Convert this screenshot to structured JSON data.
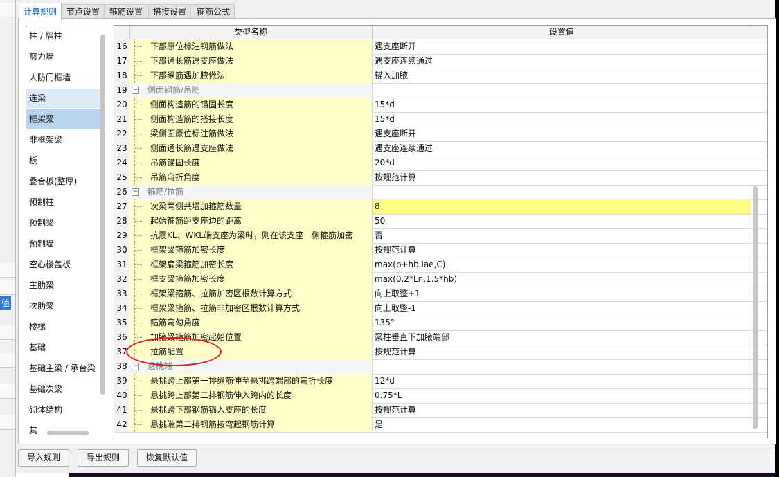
{
  "background_edge": {
    "left_label": "值"
  },
  "tabs": [
    {
      "label": "计算规则",
      "active": true
    },
    {
      "label": "节点设置",
      "active": false
    },
    {
      "label": "箍筋设置",
      "active": false
    },
    {
      "label": "搭接设置",
      "active": false
    },
    {
      "label": "箍筋公式",
      "active": false
    }
  ],
  "categories": [
    {
      "label": "柱 / 墙柱",
      "state": ""
    },
    {
      "label": "剪力墙",
      "state": ""
    },
    {
      "label": "人防门框墙",
      "state": ""
    },
    {
      "label": "连梁",
      "state": "hover"
    },
    {
      "label": "框架梁",
      "state": "selected"
    },
    {
      "label": "非框架梁",
      "state": ""
    },
    {
      "label": "板",
      "state": ""
    },
    {
      "label": "叠合板(整厚)",
      "state": ""
    },
    {
      "label": "预制柱",
      "state": ""
    },
    {
      "label": "预制梁",
      "state": ""
    },
    {
      "label": "预制墙",
      "state": ""
    },
    {
      "label": "空心楼盖板",
      "state": ""
    },
    {
      "label": "主肋梁",
      "state": ""
    },
    {
      "label": "次肋梁",
      "state": ""
    },
    {
      "label": "楼梯",
      "state": ""
    },
    {
      "label": "基础",
      "state": ""
    },
    {
      "label": "基础主梁 / 承台梁",
      "state": ""
    },
    {
      "label": "基础次梁",
      "state": ""
    },
    {
      "label": "砌体结构",
      "state": ""
    },
    {
      "label": "其",
      "state": ""
    }
  ],
  "grid": {
    "columns": [
      "类型名称",
      "设置值"
    ],
    "rows": [
      {
        "num": "16",
        "name": "下部原位标注钢筋做法",
        "value": "遇支座断开"
      },
      {
        "num": "17",
        "name": "下部通长筋遇支座做法",
        "value": "遇支座连续通过"
      },
      {
        "num": "18",
        "name": "下部纵筋遇加腋做法",
        "value": "锚入加腋"
      },
      {
        "num": "19",
        "name": "侧面钢筋/吊筋",
        "value": "",
        "group": true
      },
      {
        "num": "20",
        "name": "侧面构造筋的锚固长度",
        "value": "15*d"
      },
      {
        "num": "21",
        "name": "侧面构造筋的搭接长度",
        "value": "15*d"
      },
      {
        "num": "22",
        "name": "梁侧面原位标注筋做法",
        "value": "遇支座断开"
      },
      {
        "num": "23",
        "name": "侧面通长筋遇支座做法",
        "value": "遇支座连续通过"
      },
      {
        "num": "24",
        "name": "吊筋锚固长度",
        "value": "20*d"
      },
      {
        "num": "25",
        "name": "吊筋弯折角度",
        "value": "按规范计算"
      },
      {
        "num": "26",
        "name": "箍筋/拉筋",
        "value": "",
        "group": true
      },
      {
        "num": "27",
        "name": "次梁两侧共增加箍筋数量",
        "value": "8",
        "highlight": true
      },
      {
        "num": "28",
        "name": "起始箍筋距支座边的距离",
        "value": "50"
      },
      {
        "num": "29",
        "name": "抗震KL、WKL端支座为梁时，则在该支座一侧箍筋加密",
        "value": "否"
      },
      {
        "num": "30",
        "name": "框架梁箍筋加密长度",
        "value": "按规范计算"
      },
      {
        "num": "31",
        "name": "框架扁梁箍筋加密长度",
        "value": "max(b+hb,lae,C)"
      },
      {
        "num": "32",
        "name": "框支梁箍筋加密长度",
        "value": "max(0.2*Ln,1.5*hb)"
      },
      {
        "num": "33",
        "name": "框架梁箍筋、拉筋加密区根数计算方式",
        "value": "向上取整+1"
      },
      {
        "num": "34",
        "name": "框架梁箍筋、拉筋非加密区根数计算方式",
        "value": "向上取整-1"
      },
      {
        "num": "35",
        "name": "箍筋弯勾角度",
        "value": "135°"
      },
      {
        "num": "36",
        "name": "加腋梁箍筋加密起始位置",
        "value": "梁柱垂直下加腋端部"
      },
      {
        "num": "37",
        "name": "拉筋配置",
        "value": "按规范计算"
      },
      {
        "num": "38",
        "name": "悬挑端",
        "value": "",
        "group": true
      },
      {
        "num": "39",
        "name": "悬挑跨上部第一排纵筋伸至悬挑跨端部的弯折长度",
        "value": "12*d"
      },
      {
        "num": "40",
        "name": "悬挑跨上部第二排钢筋伸入跨内的长度",
        "value": "0.75*L"
      },
      {
        "num": "41",
        "name": "悬挑跨下部钢筋锚入支座的长度",
        "value": "按规范计算"
      },
      {
        "num": "42",
        "name": "悬挑端第二排钢筋按弯起钢筋计算",
        "value": "是"
      }
    ]
  },
  "buttons": {
    "import": "导入规则",
    "export": "导出规则",
    "restore": "恢复默认值"
  },
  "colors": {
    "name_column_bg": "#ffffc8",
    "highlight_value_bg": "#ffff88",
    "active_tab_text": "#0a63c9",
    "selected_category_bg": "#b9d4f0",
    "annotation_circle": "#e02020"
  }
}
